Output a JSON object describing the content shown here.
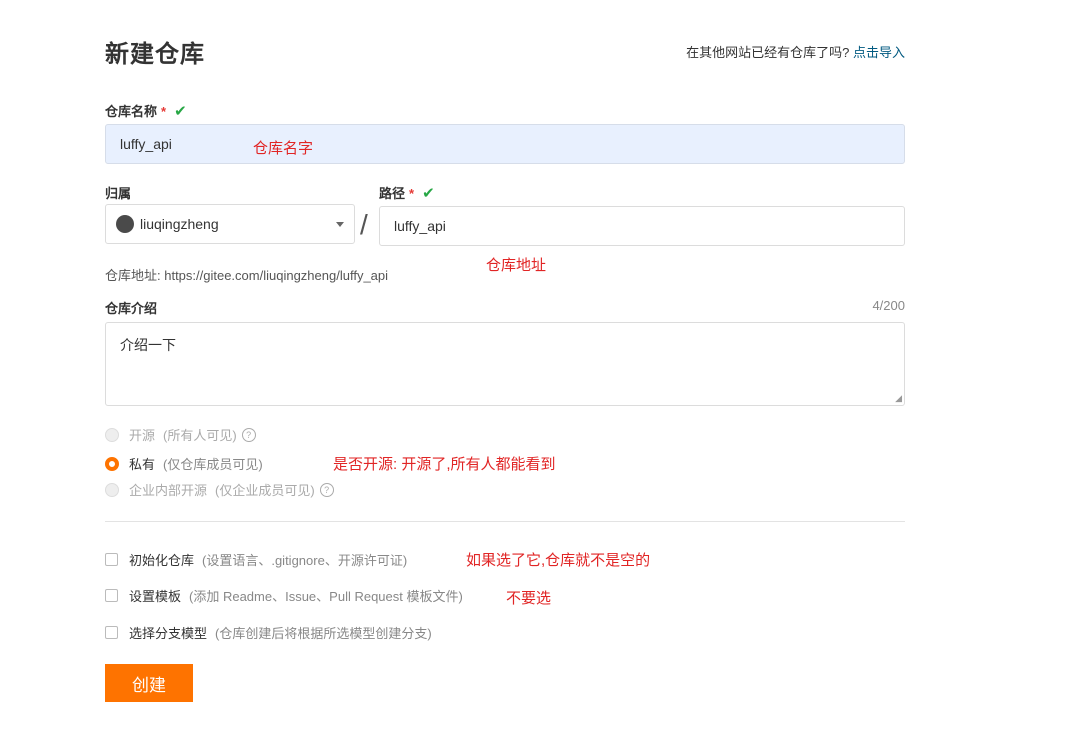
{
  "header": {
    "title": "新建仓库",
    "import_prompt": "在其他网站已经有仓库了吗?",
    "import_link": "点击导入"
  },
  "repo_name": {
    "label": "仓库名称",
    "required_mark": "*",
    "value": "luffy_api",
    "annotation": "仓库名字"
  },
  "owner": {
    "label": "归属",
    "value": "liuqingzheng"
  },
  "separator": "/",
  "path": {
    "label": "路径",
    "required_mark": "*",
    "value": "luffy_api"
  },
  "repo_url": {
    "text": "仓库地址: https://gitee.com/liuqingzheng/luffy_api",
    "annotation": "仓库地址"
  },
  "description": {
    "label": "仓库介绍",
    "counter": "4/200",
    "value": "介绍一下"
  },
  "visibility": {
    "options": [
      {
        "label": "开源",
        "hint": "(所有人可见)",
        "selected": false,
        "disabled": true
      },
      {
        "label": "私有",
        "hint": "(仅仓库成员可见)",
        "selected": true,
        "disabled": false
      },
      {
        "label": "企业内部开源",
        "hint": "(仅企业成员可见)",
        "selected": false,
        "disabled": true
      }
    ],
    "annotation": "是否开源: 开源了,所有人都能看到"
  },
  "options": [
    {
      "label": "初始化仓库",
      "hint": "(设置语言、.gitignore、开源许可证)",
      "annotation": "如果选了它,仓库就不是空的"
    },
    {
      "label": "设置模板",
      "hint": "(添加 Readme、Issue、Pull Request 模板文件)",
      "annotation": "不要选"
    },
    {
      "label": "选择分支模型",
      "hint": "(仓库创建后将根据所选模型创建分支)",
      "annotation": ""
    }
  ],
  "submit_label": "创建",
  "colors": {
    "accent": "#fe7300",
    "link": "#005980",
    "annotation": "#e12525",
    "check": "#27a745"
  }
}
